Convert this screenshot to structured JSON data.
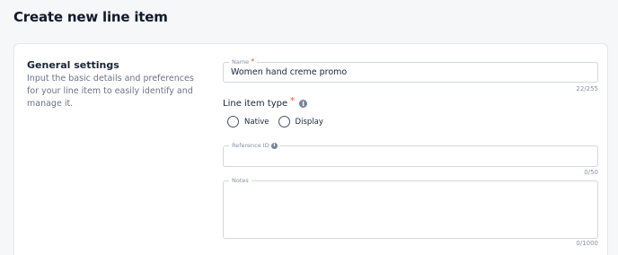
{
  "page": {
    "title": "Create new line item"
  },
  "general": {
    "title": "General settings",
    "description": "Input the basic details and preferences for your line item to easily identify and manage it."
  },
  "fields": {
    "name": {
      "label": "Name",
      "required_mark": "*",
      "value": "Women hand creme promo",
      "counter": "22/255"
    },
    "line_item_type": {
      "label": "Line item type",
      "required_mark": "*",
      "options": [
        {
          "label": "Native"
        },
        {
          "label": "Display"
        }
      ]
    },
    "reference_id": {
      "label": "Reference ID",
      "value": "",
      "counter": "0/50"
    },
    "notes": {
      "label": "Notes",
      "value": "",
      "counter": "0/1000"
    }
  },
  "icons": {
    "info": "info-icon",
    "radio": "radio-unchecked-icon"
  },
  "colors": {
    "required": "#e8602c",
    "border": "#d3d7de",
    "text": "#1b2436",
    "muted": "#6b7385"
  }
}
